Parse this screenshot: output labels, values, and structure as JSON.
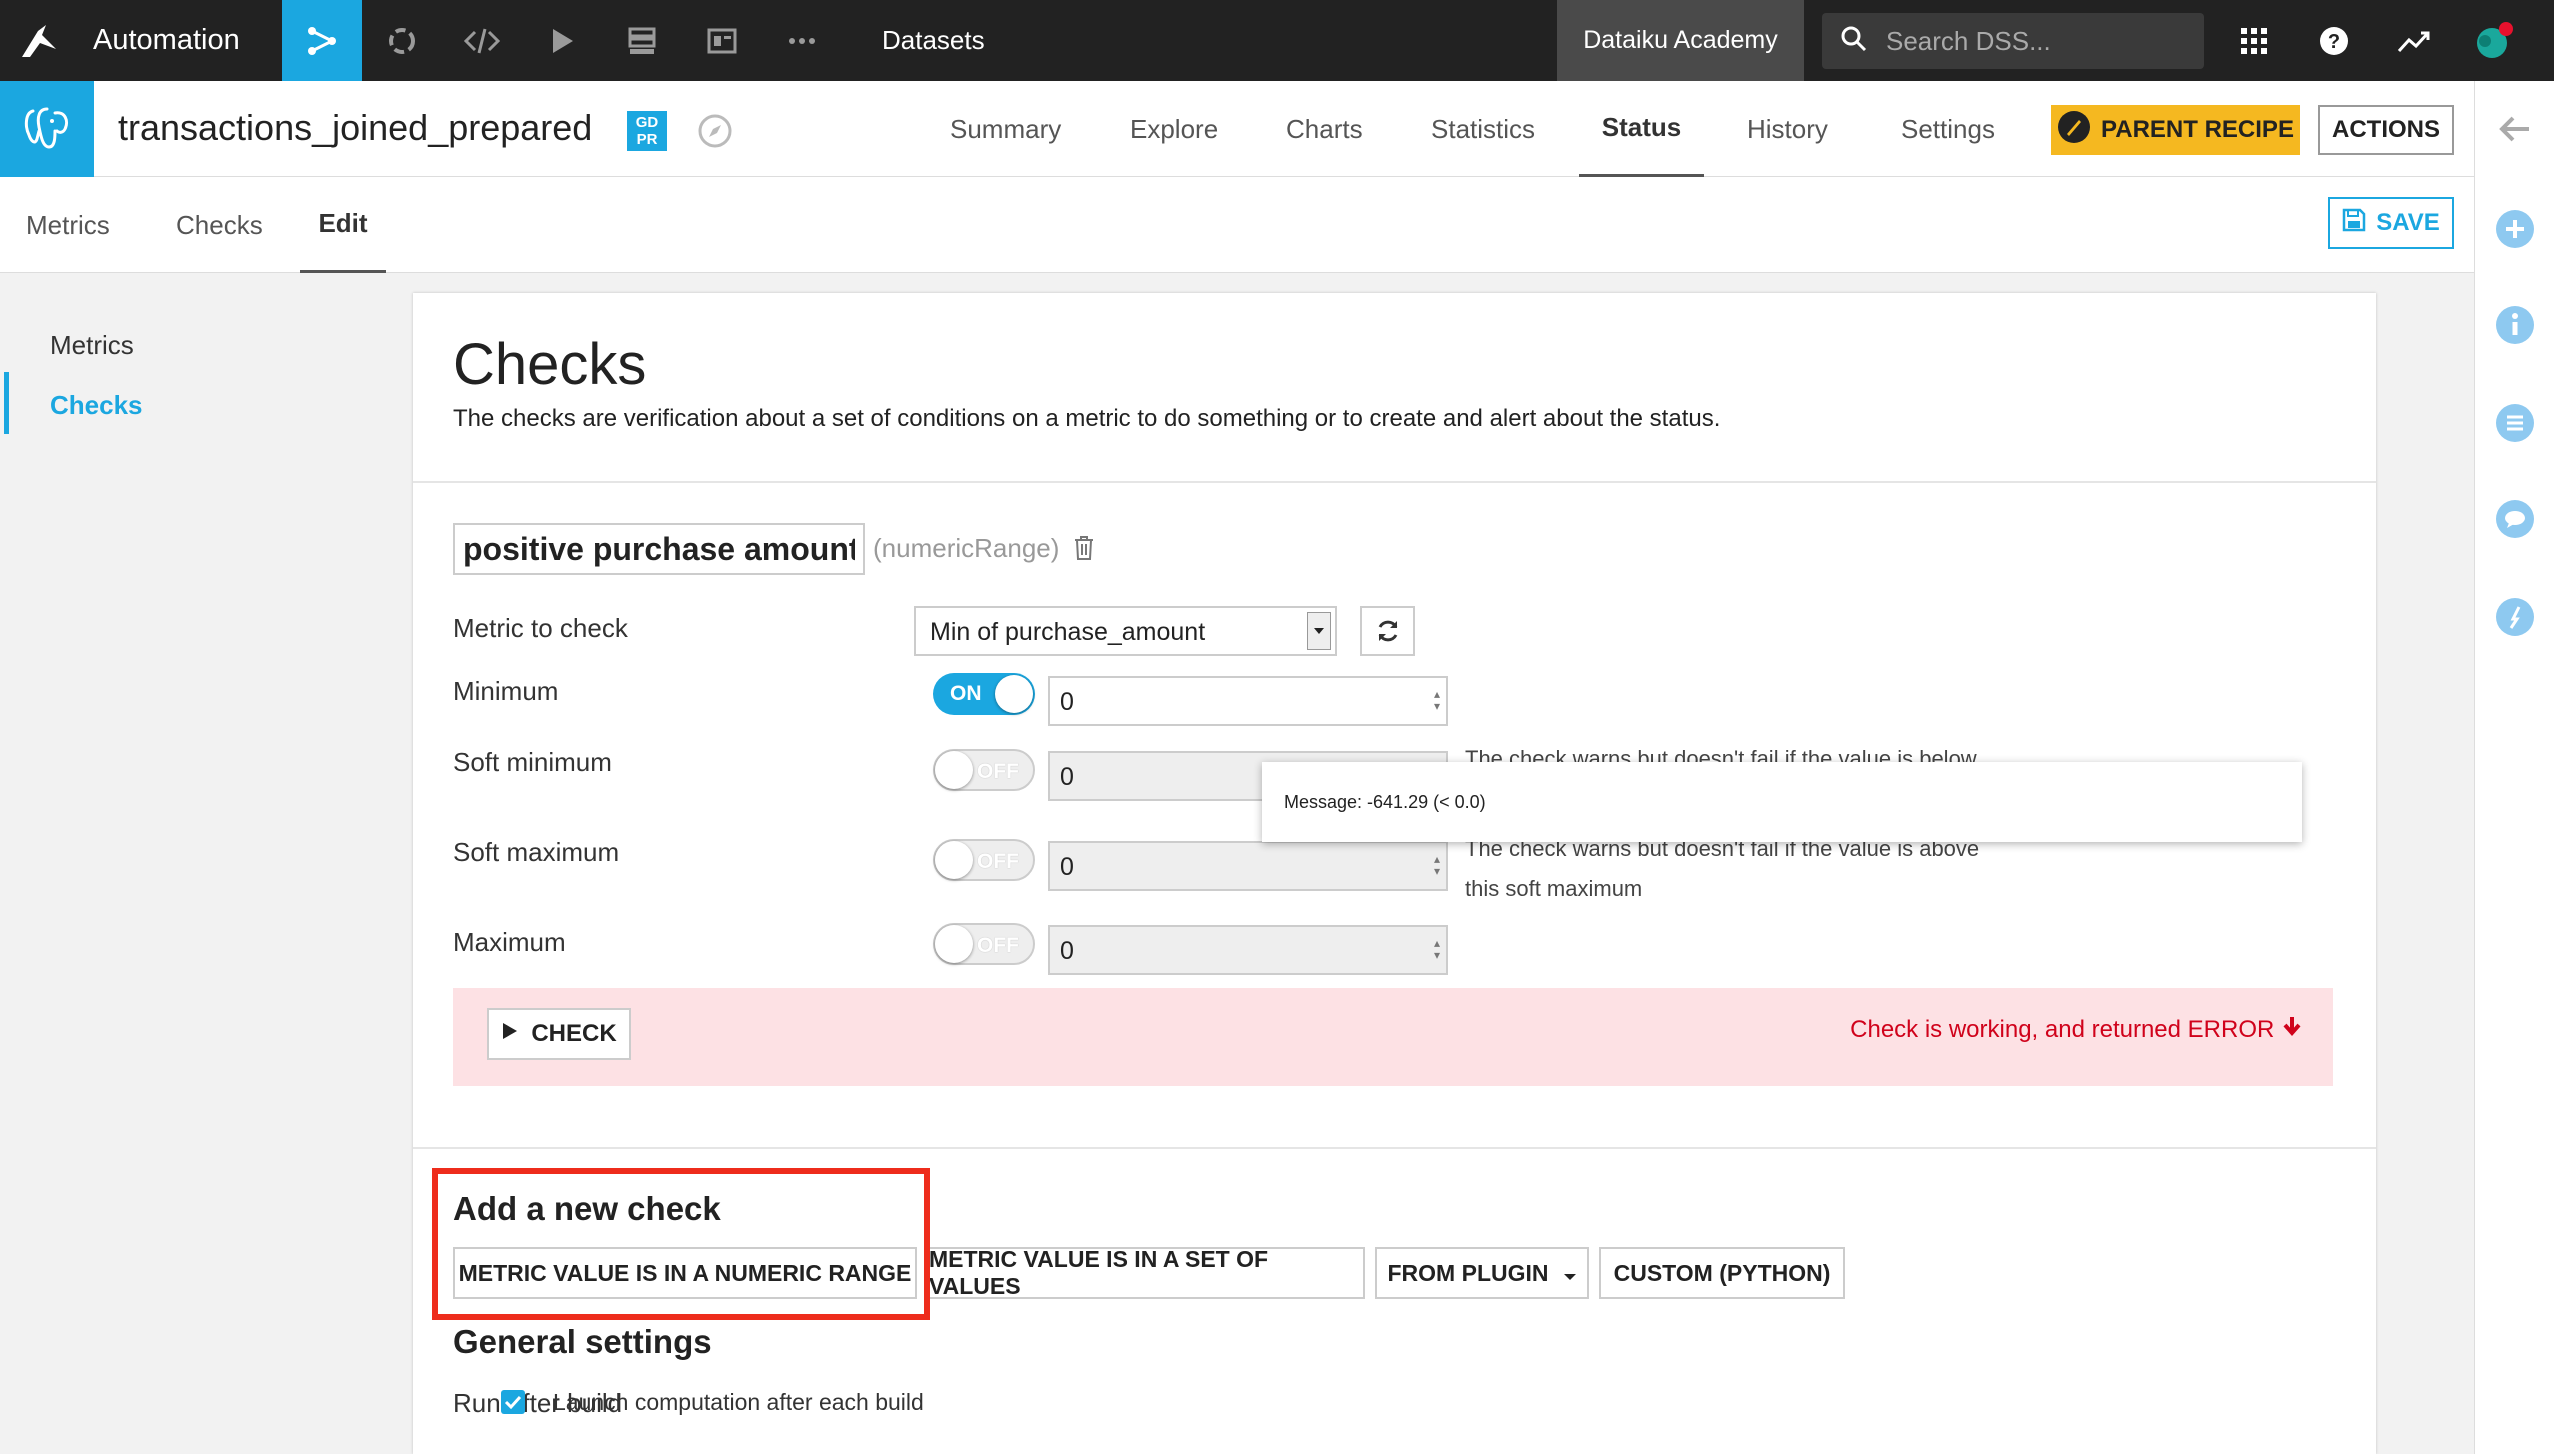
{
  "topbar": {
    "project_name": "Automation",
    "section": "Datasets",
    "academy": "Dataiku Academy",
    "search_placeholder": "Search DSS..."
  },
  "dataset": {
    "name": "transactions_joined_prepared",
    "gdpr_badge": "GD PR",
    "tabs": [
      "Summary",
      "Explore",
      "Charts",
      "Statistics",
      "Status",
      "History",
      "Settings"
    ],
    "active_tab": "Status",
    "parent_recipe_label": "PARENT RECIPE",
    "actions_label": "ACTIONS"
  },
  "subtabs": {
    "items": [
      "Metrics",
      "Checks",
      "Edit"
    ],
    "active": "Edit",
    "save_label": "SAVE"
  },
  "leftnav": {
    "items": [
      "Metrics",
      "Checks"
    ],
    "active": "Checks"
  },
  "panel": {
    "title": "Checks",
    "description": "The checks are verification about a set of conditions on a metric to do something or to create and alert about the status."
  },
  "check": {
    "name": "positive purchase amount",
    "type": "(numericRange)",
    "metric_label": "Metric to check",
    "metric_value": "Min of purchase_amount",
    "rows": [
      {
        "label": "Minimum",
        "toggle": "ON",
        "value": "0",
        "help": ""
      },
      {
        "label": "Soft minimum",
        "toggle": "OFF",
        "value": "0",
        "help": "The check warns but doesn't fail if the value is below this soft minimum"
      },
      {
        "label": "Soft maximum",
        "toggle": "OFF",
        "value": "0",
        "help": "The check warns but doesn't fail if the value is above this soft maximum"
      },
      {
        "label": "Maximum",
        "toggle": "OFF",
        "value": "0",
        "help": ""
      }
    ],
    "check_button": "CHECK",
    "result_text": "Check is working, and returned ERROR",
    "message": "Message: -641.29 (< 0.0)"
  },
  "add_check": {
    "title": "Add a new check",
    "buttons": [
      "METRIC VALUE IS IN A NUMERIC RANGE",
      "METRIC VALUE IS IN A SET OF VALUES",
      "FROM PLUGIN",
      "CUSTOM (PYTHON)"
    ]
  },
  "general": {
    "title": "General settings",
    "run_after_build_label": "Run after build",
    "run_after_build_checked": true,
    "checkbox_label": "Launch computation after each build"
  },
  "colors": {
    "accent": "#1ba7e0",
    "parent_recipe": "#f5b820",
    "error": "#d0021b",
    "error_bg": "#fde1e4",
    "highlight": "#ee2c1c"
  }
}
